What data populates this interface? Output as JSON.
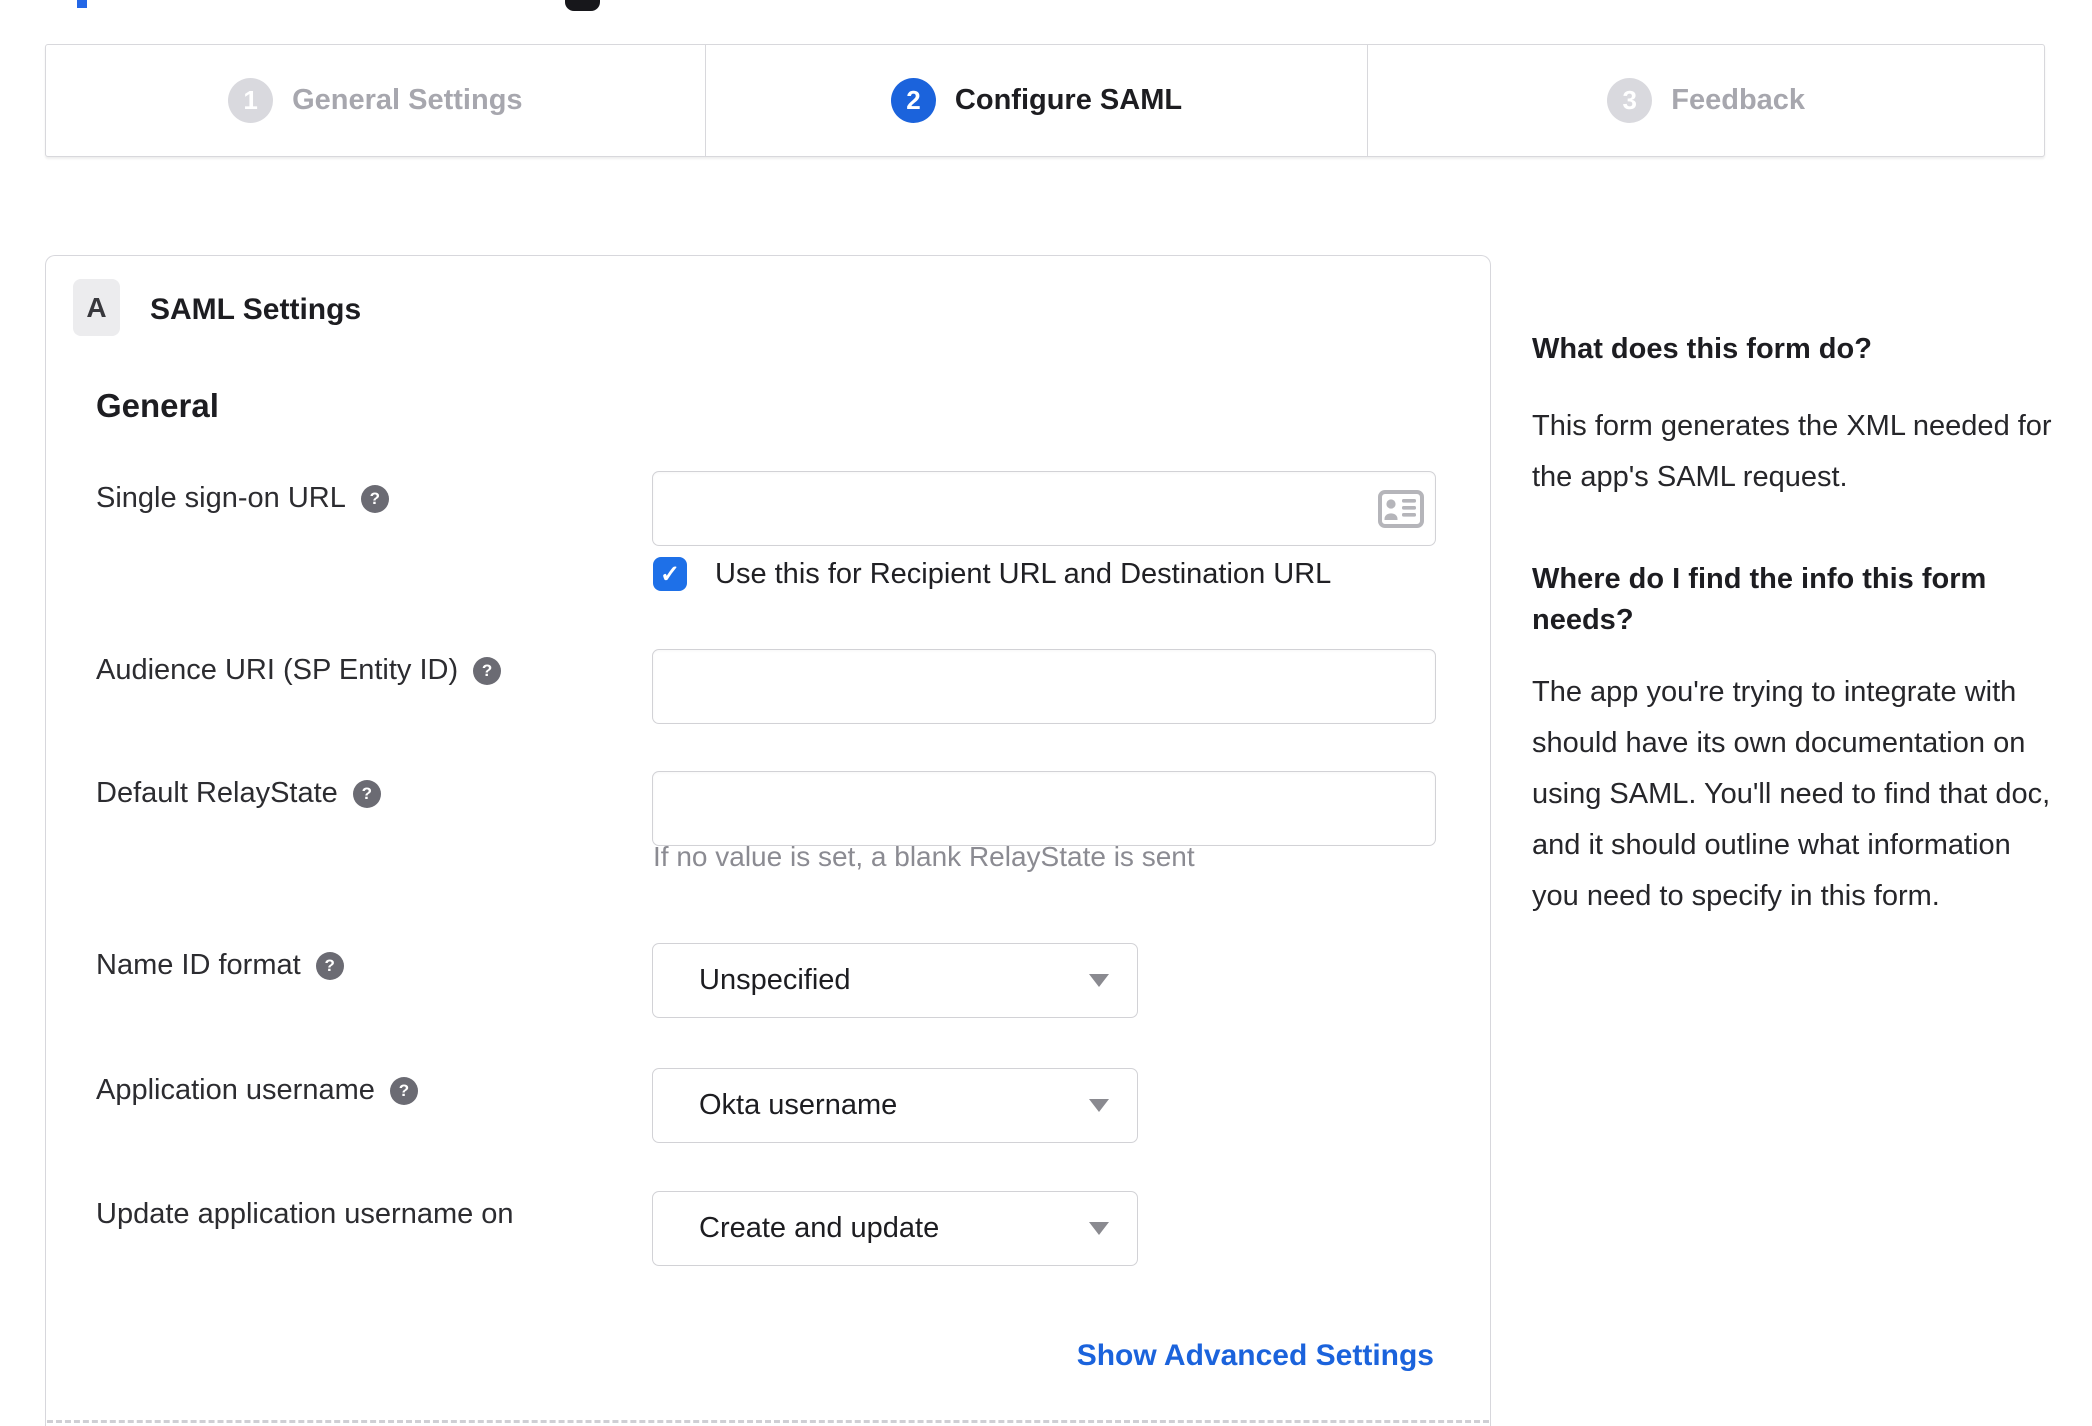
{
  "theme": {
    "accent_blue": "#1b63dc",
    "checkbox_blue": "#1e70e8",
    "inactive_gray": "#d9d9de",
    "link_blue": "#1b63dc"
  },
  "glyphs": {
    "help": "?",
    "check": "✓"
  },
  "stepper": {
    "steps": [
      {
        "number": "1",
        "label": "General Settings",
        "state": "inactive"
      },
      {
        "number": "2",
        "label": "Configure SAML",
        "state": "active"
      },
      {
        "number": "3",
        "label": "Feedback",
        "state": "inactive"
      }
    ]
  },
  "panel": {
    "badge": "A",
    "title": "SAML Settings",
    "section": "General",
    "fields": {
      "sso": {
        "label": "Single sign-on URL",
        "value": "",
        "checkbox_label": "Use this for Recipient URL and Destination URL",
        "checkbox_checked": true
      },
      "audience": {
        "label": "Audience URI (SP Entity ID)",
        "value": ""
      },
      "relay": {
        "label": "Default RelayState",
        "value": "",
        "hint": "If no value is set, a blank RelayState is sent"
      },
      "name_id": {
        "label": "Name ID format",
        "value": "Unspecified"
      },
      "app_username": {
        "label": "Application username",
        "value": "Okta username"
      },
      "update_username": {
        "label": "Update application username on",
        "value": "Create and update"
      }
    },
    "advanced_link": "Show Advanced Settings"
  },
  "sidebar": {
    "q1": {
      "title": "What does this form do?",
      "body": "This form generates the XML needed for the app's SAML request."
    },
    "q2": {
      "title": "Where do I find the info this form needs?",
      "body": "The app you're trying to integrate with should have its own documentation on using SAML. You'll need to find that doc, and it should outline what information you need to specify in this form."
    }
  }
}
